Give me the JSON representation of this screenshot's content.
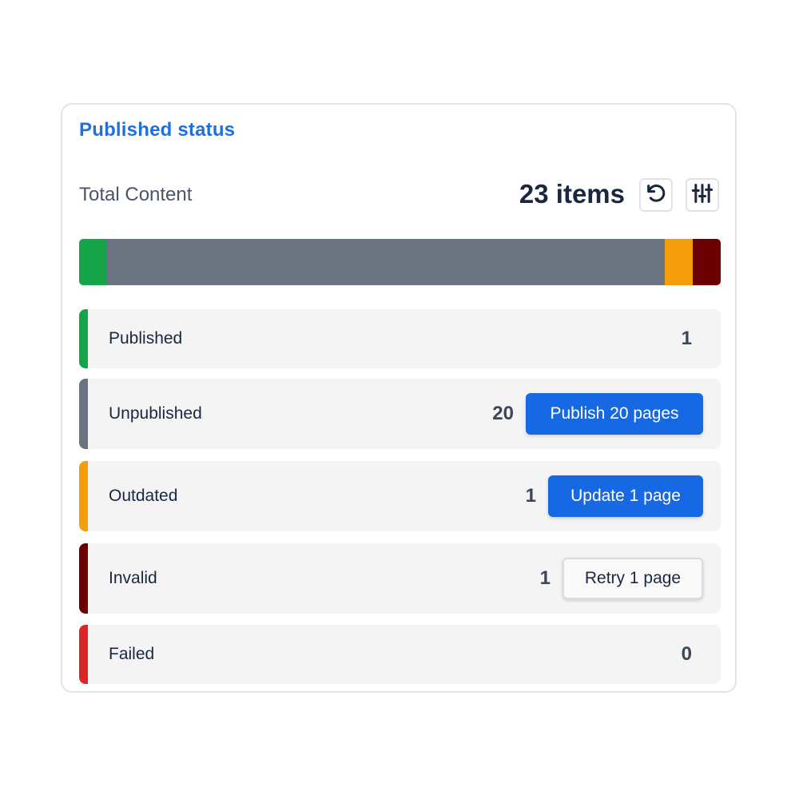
{
  "card": {
    "title": "Published status"
  },
  "total": {
    "label": "Total Content",
    "count_text": "23 items"
  },
  "icons": {
    "refresh": "refresh-icon",
    "settings": "sliders-icon"
  },
  "progress_bar": {
    "segments": [
      {
        "name": "Published",
        "value": 1,
        "color": "#16a34a"
      },
      {
        "name": "Unpublished",
        "value": 20,
        "color": "#6b7280"
      },
      {
        "name": "Outdated",
        "value": 1,
        "color": "#f59e0b"
      },
      {
        "name": "Invalid",
        "value": 1,
        "color": "#6b0000"
      },
      {
        "name": "Failed",
        "value": 0,
        "color": "#dc2626"
      }
    ]
  },
  "rows": [
    {
      "label": "Published",
      "count": "1",
      "color": "#16a34a",
      "action": null
    },
    {
      "label": "Unpublished",
      "count": "20",
      "color": "#6b7280",
      "action": {
        "label": "Publish 20 pages",
        "style": "primary"
      }
    },
    {
      "label": "Outdated",
      "count": "1",
      "color": "#f59e0b",
      "action": {
        "label": "Update 1 page",
        "style": "primary"
      }
    },
    {
      "label": "Invalid",
      "count": "1",
      "color": "#6b0000",
      "action": {
        "label": "Retry 1 page",
        "style": "secondary"
      }
    },
    {
      "label": "Failed",
      "count": "0",
      "color": "#dc2626",
      "action": null
    }
  ]
}
